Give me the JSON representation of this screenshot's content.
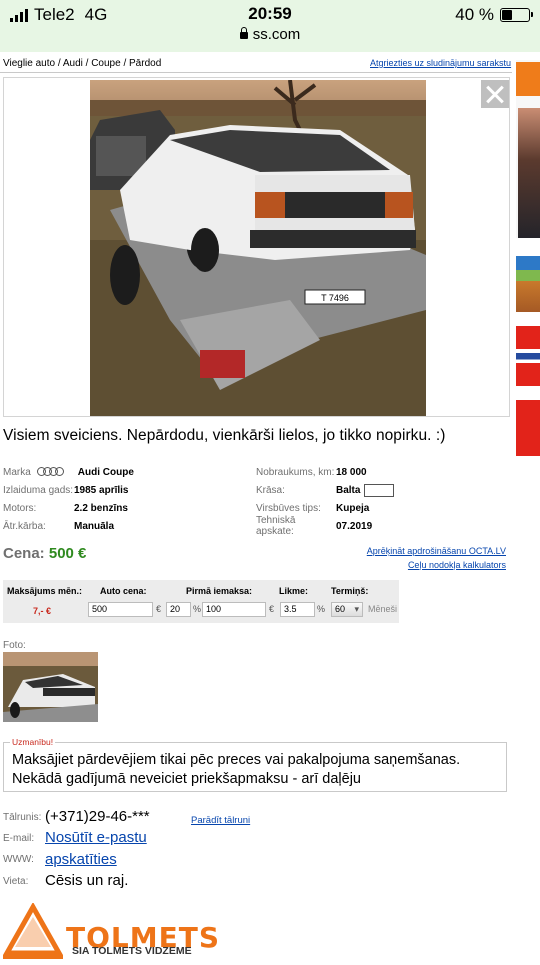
{
  "status_bar": {
    "carrier": "Tele2",
    "network": "4G",
    "time": "20:59",
    "url": "ss.com",
    "battery": "40 %",
    "battery_level": 0.4
  },
  "breadcrumb": {
    "path": "Vieglie auto / Audi / Coupe / Pārdod",
    "back_link": "Atgriezties uz sludinājumu sarakstu"
  },
  "description": "Visiem sveiciens. Nepārdodu, vienkārši lielos, jo tikko nopirku. :)",
  "specs_left": [
    {
      "label": "Marka",
      "value": "Audi Coupe",
      "icon": "audi-rings-icon"
    },
    {
      "label": "Izlaiduma gads:",
      "value": "1985 aprīlis"
    },
    {
      "label": "Motors:",
      "value": "2.2 benzīns"
    },
    {
      "label": "Ātr.kārba:",
      "value": "Manuāla"
    }
  ],
  "specs_right": [
    {
      "label": "Nobraukums, km:",
      "value": "18 000"
    },
    {
      "label": "Krāsa:",
      "value": "Balta",
      "swatch": "#ffffff"
    },
    {
      "label": "Virsbūves tips:",
      "value": "Kupeja"
    },
    {
      "label": "Tehniskā apskate:",
      "value": "07.2019"
    }
  ],
  "price": {
    "label": "Cena:",
    "value": "500 €"
  },
  "links": {
    "insurance": "Aprēķināt apdrošināšanu OCTA.LV",
    "tax": "Ceļu nodokļa kalkulators"
  },
  "calculator": {
    "headers": {
      "monthly": "Maksājums mēn.:",
      "price": "Auto cena:",
      "first": "Pirmā iemaksa:",
      "rate": "Likme:",
      "term": "Termiņš:"
    },
    "monthly_value": "7,- €",
    "price_value": "500",
    "currency": "€",
    "first_percent": "20",
    "percent_sign": "%",
    "first_value": "100",
    "rate_value": "3.5",
    "term_value": "60",
    "term_unit": "Mēneši"
  },
  "photos_label": "Foto:",
  "warning": {
    "label": "Uzmanību!",
    "text": "Maksājiet pārdevējiem tikai pēc preces vai pakalpojuma saņemšanas. Nekādā gadījumā neveiciet priekšapmaksu - arī daļēju"
  },
  "contact": {
    "phone_label": "Tālrunis:",
    "phone_value": "(+371)29-46-***",
    "phone_show": "Parādīt tālruni",
    "email_label": "E-mail:",
    "email_value": "Nosūtīt e-pastu",
    "www_label": "WWW:",
    "www_value": "apskatīties",
    "place_label": "Vieta:",
    "place_value": "Cēsis un raj."
  },
  "dealer_logo": {
    "name": "TOLMETS",
    "subtitle": "SIA TOLMETS VIDZEME",
    "color": "#ee7418"
  },
  "colors": {
    "status_bg": "#e7f6e4",
    "link": "#0645ad",
    "price_green": "#2f8a1f",
    "warning_red": "#c8281d"
  }
}
